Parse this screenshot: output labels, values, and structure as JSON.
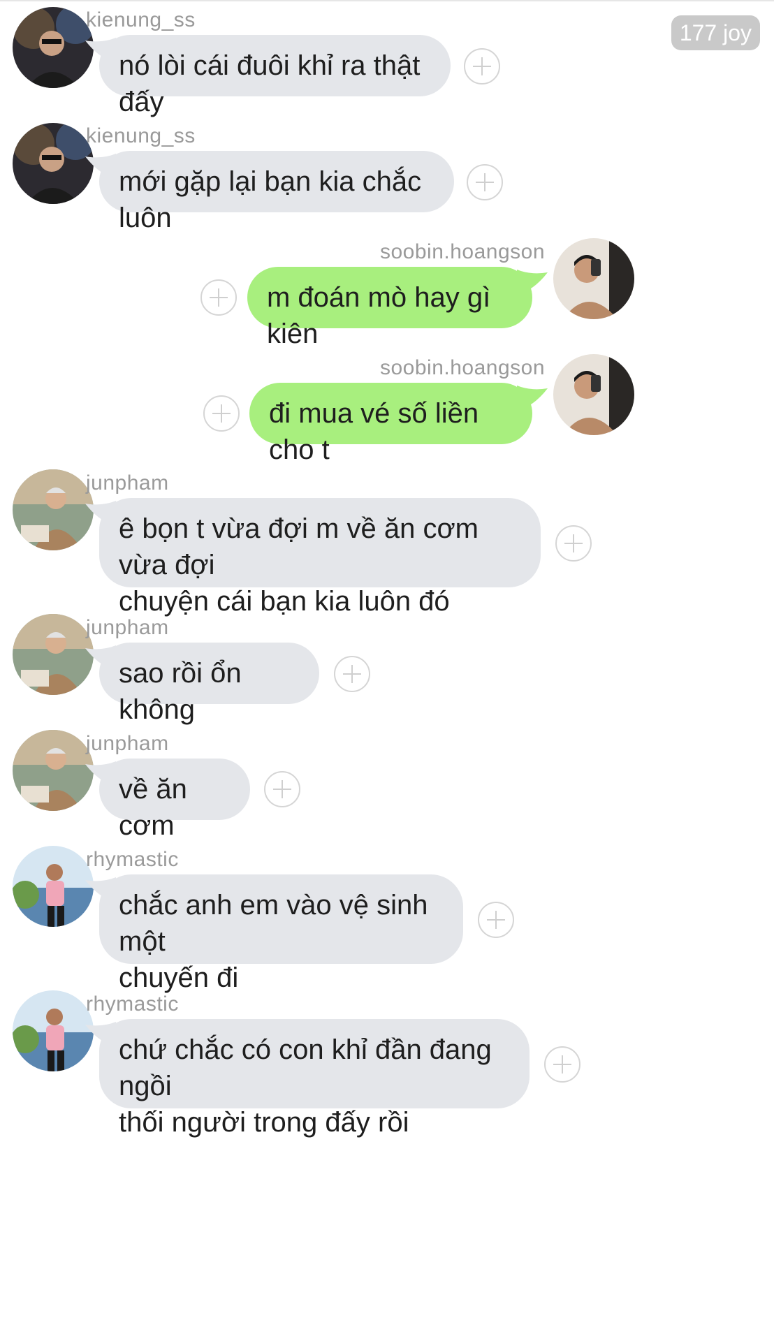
{
  "header": {
    "badge": "177 joy"
  },
  "messages": [
    {
      "user": "kienung_ss",
      "text_lines": [
        "nó lòi cái đuôi khỉ ra thật đấy"
      ],
      "direction": "incoming",
      "avatar": "kienung-avatar"
    },
    {
      "user": "kienung_ss",
      "text_lines": [
        "mới gặp lại bạn kia chắc luôn"
      ],
      "direction": "incoming",
      "avatar": "kienung-avatar"
    },
    {
      "user": "soobin.hoangson",
      "text_lines": [
        "m đoán mò hay gì kiên"
      ],
      "direction": "outgoing",
      "avatar": "soobin-avatar"
    },
    {
      "user": "soobin.hoangson",
      "text_lines": [
        "đi mua vé số liền cho t"
      ],
      "direction": "outgoing",
      "avatar": "soobin-avatar"
    },
    {
      "user": "junpham",
      "text_lines": [
        "ê bọn t vừa đợi m về ăn cơm vừa đợi",
        "chuyện cái bạn kia luôn đó"
      ],
      "direction": "incoming",
      "avatar": "junpham-avatar"
    },
    {
      "user": "junpham",
      "text_lines": [
        "sao rồi ổn không"
      ],
      "direction": "incoming",
      "avatar": "junpham-avatar"
    },
    {
      "user": "junpham",
      "text_lines": [
        "về ăn cơm"
      ],
      "direction": "incoming",
      "avatar": "junpham-avatar"
    },
    {
      "user": "rhymastic",
      "text_lines": [
        "chắc anh em vào vệ sinh một",
        "chuyến đi"
      ],
      "direction": "incoming",
      "avatar": "rhymastic-avatar"
    },
    {
      "user": "rhymastic",
      "text_lines": [
        "chứ chắc có con khỉ đần đang ngồi",
        "thối người trong đấy rồi"
      ],
      "direction": "incoming",
      "avatar": "rhymastic-avatar"
    }
  ],
  "colors": {
    "incoming_bubble": "#e4e6ea",
    "outgoing_bubble": "#a8ef7e",
    "username": "#9a9a9a",
    "badge_bg": "#c9c9c9"
  },
  "icons": {
    "reaction": "plus-circle-icon"
  }
}
